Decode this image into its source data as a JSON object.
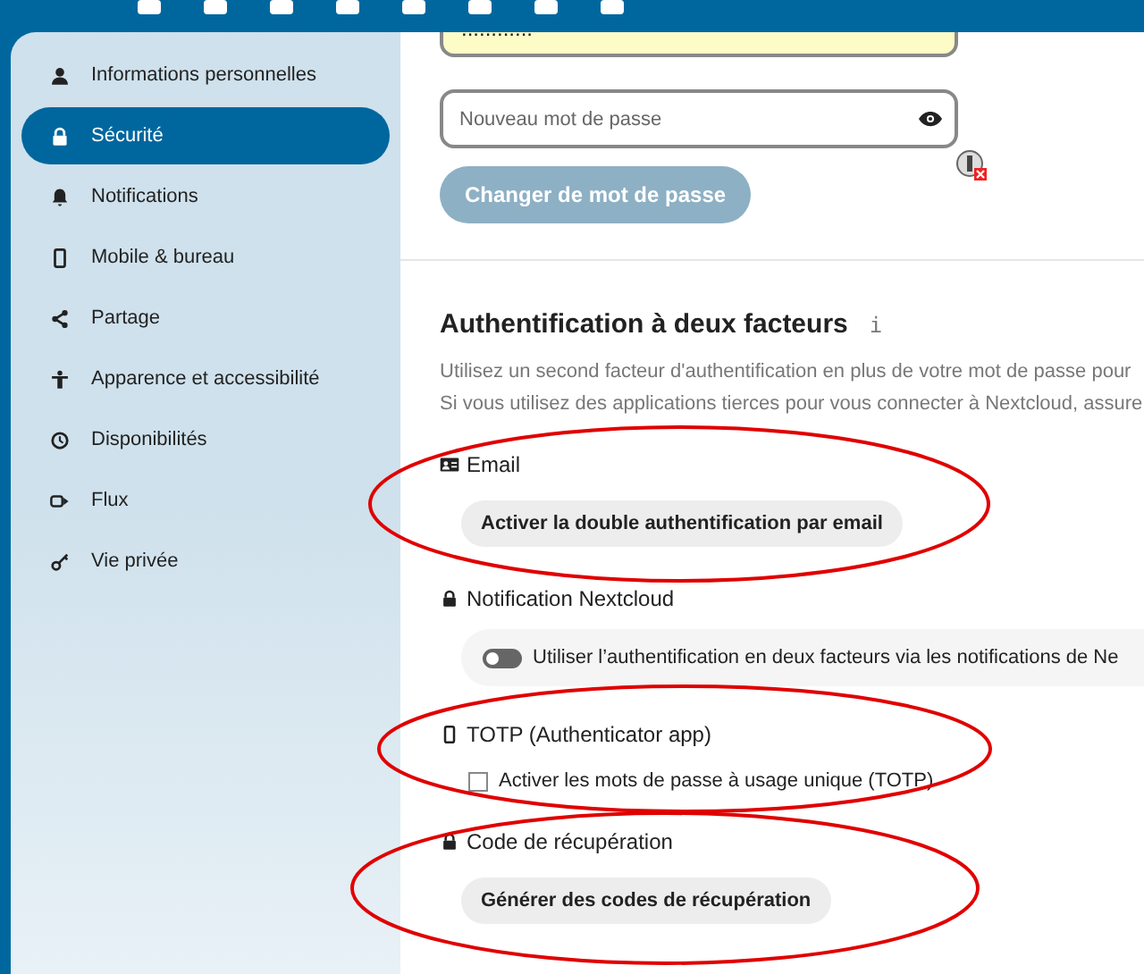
{
  "sidebar": {
    "items": [
      {
        "label": "Informations personnelles",
        "selected": false
      },
      {
        "label": "Sécurité",
        "selected": true
      },
      {
        "label": "Notifications",
        "selected": false
      },
      {
        "label": "Mobile & bureau",
        "selected": false
      },
      {
        "label": "Partage",
        "selected": false
      },
      {
        "label": "Apparence et accessibilité",
        "selected": false
      },
      {
        "label": "Disponibilités",
        "selected": false
      },
      {
        "label": "Flux",
        "selected": false
      },
      {
        "label": "Vie privée",
        "selected": false
      }
    ]
  },
  "password": {
    "current_value": "............",
    "new_placeholder": "Nouveau mot de passe",
    "button": "Changer de mot de passe"
  },
  "two_factor": {
    "title": "Authentification à deux facteurs",
    "info": "i",
    "description": [
      "Utilisez un second facteur d'authentification en plus de votre mot de passe pour",
      "Si vous utilisez des applications tierces pour vous connecter à Nextcloud, assure"
    ],
    "providers": [
      {
        "title": "Email",
        "kind": "button",
        "label": "Activer la double authentification par email"
      },
      {
        "title": "Notification Nextcloud",
        "kind": "toggle",
        "label": "Utiliser l’authentification en deux facteurs via les notifications de Ne",
        "on": false
      },
      {
        "title": "TOTP (Authenticator app)",
        "kind": "checkbox",
        "label": "Activer les mots de passe à usage unique (TOTP)",
        "checked": false
      },
      {
        "title": "Code de récupération",
        "kind": "button",
        "label": "Générer des codes de récupération"
      }
    ]
  }
}
